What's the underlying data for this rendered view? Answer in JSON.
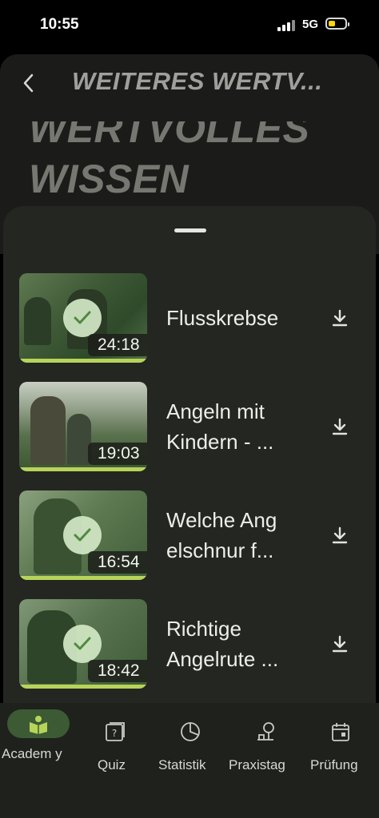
{
  "status_bar": {
    "time": "10:55",
    "network": "5G"
  },
  "header": {
    "title": "WEITERES WERTV...",
    "big_title_line1": "WERTVOLLES",
    "big_title_line2": "WISSEN"
  },
  "videos": [
    {
      "title": "Flusskrebse",
      "duration": "24:18",
      "watched": true
    },
    {
      "title": "Angeln mit Kindern - ...",
      "duration": "19:03",
      "watched": false
    },
    {
      "title": "Welche Ang elschnur f...",
      "duration": "16:54",
      "watched": true
    },
    {
      "title": "Richtige Angelrute ...",
      "duration": "18:42",
      "watched": true
    }
  ],
  "nav": [
    {
      "label": "Academ y",
      "icon": "book-reader-icon",
      "active": true
    },
    {
      "label": "Quiz",
      "icon": "quiz-icon",
      "active": false
    },
    {
      "label": "Statistik",
      "icon": "pie-chart-icon",
      "active": false
    },
    {
      "label": "Praxistag",
      "icon": "practice-icon",
      "active": false
    },
    {
      "label": "Prüfung",
      "icon": "calendar-icon",
      "active": false
    }
  ],
  "colors": {
    "accent": "#b7d45a",
    "active_pill": "#3c5a34",
    "sheet": "#242621"
  }
}
